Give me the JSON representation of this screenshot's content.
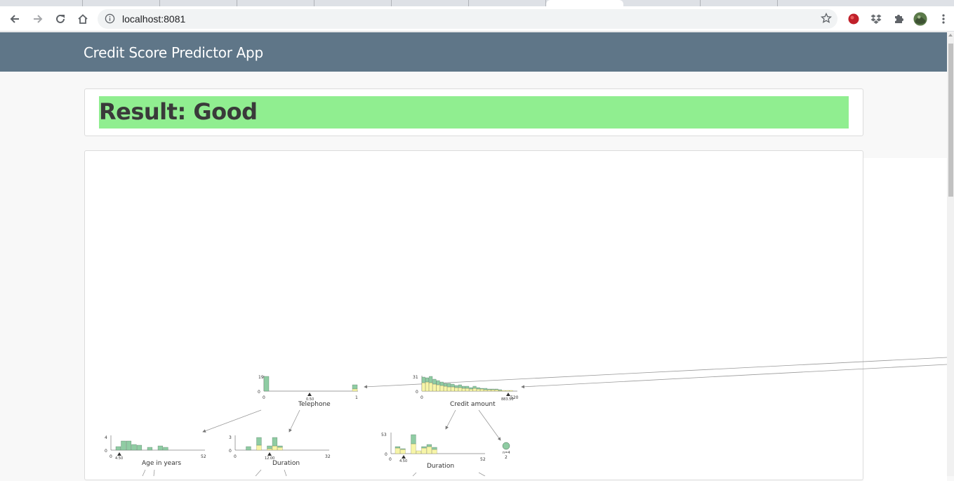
{
  "browser": {
    "url": "localhost:8081",
    "icons": [
      "back-icon",
      "forward-icon",
      "reload-icon",
      "home-icon",
      "info-icon",
      "star-icon",
      "extension-red-icon",
      "dropbox-icon",
      "puzzle-icon",
      "profile-avatar",
      "menu-icon"
    ]
  },
  "app": {
    "title": "Credit Score Predictor App",
    "result_text": "Result: Good",
    "result_color": "#90ee90"
  },
  "tree": {
    "colors": {
      "good": "#8fcca3",
      "bad": "#f7f5a8"
    },
    "nodes": {
      "telephone": {
        "label": "Telephone",
        "ymax": "19",
        "ymin": "0",
        "xmin": "0",
        "xmax": "1",
        "split": "0.50"
      },
      "credit_amount": {
        "label": "Credit amount",
        "ymax": "31",
        "ymin": "0",
        "xmin": "0",
        "xmax": "520",
        "split": "883.50"
      },
      "age": {
        "label": "Age in years",
        "ymax": "4",
        "ymin": "0",
        "xmin": "0",
        "xmax": "52",
        "split": "4.50"
      },
      "duration_left": {
        "label": "Duration",
        "ymax": "3",
        "ymin": "0",
        "xmin": "0",
        "xmax": "32",
        "split": "12.00"
      },
      "duration_right": {
        "label": "Duration",
        "ymax": "53",
        "ymin": "0",
        "xmin": "0",
        "xmax": "52",
        "split": "4.50"
      },
      "leaf": {
        "n": "n=4",
        "value": "2"
      }
    }
  }
}
